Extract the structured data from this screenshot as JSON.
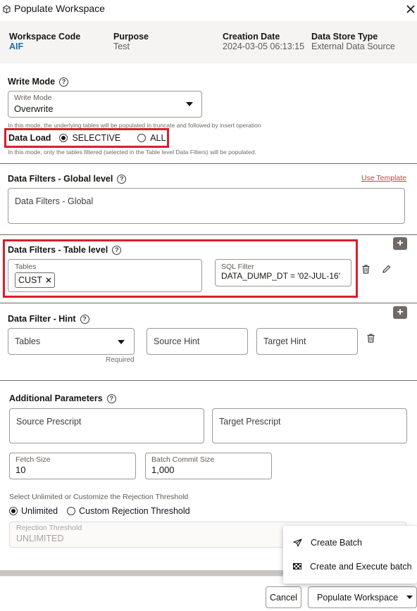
{
  "dialog": {
    "title": "Populate Workspace",
    "info": [
      {
        "label": "Workspace Code",
        "value": "AIF"
      },
      {
        "label": "Purpose",
        "value": "Test"
      },
      {
        "label": "Creation Date",
        "value": "2024-03-05 06:13:15"
      },
      {
        "label": "Data Store Type",
        "value": "External Data Source"
      }
    ]
  },
  "write_mode": {
    "section_title": "Write Mode",
    "field_label": "Write Mode",
    "value": "Overwrite",
    "hint": "In this mode, the underlying tables will be populated in truncate and followed by insert operation"
  },
  "data_load": {
    "label": "Data Load",
    "options": [
      "SELECTIVE",
      "ALL"
    ],
    "selected": "SELECTIVE",
    "hint": "In this mode, only the tables filtered (selected in the Table level Data Filters) will be populated."
  },
  "global_filters": {
    "section_title": "Data Filters - Global level",
    "use_template": "Use Template",
    "placeholder": "Data Filters - Global"
  },
  "table_filters": {
    "section_title": "Data Filters - Table level",
    "tables_label": "Tables",
    "chip": "CUST",
    "sql_label": "SQL Filter",
    "sql_value": "DATA_DUMP_DT = '02-JUL-16'"
  },
  "hint_filter": {
    "section_title": "Data Filter - Hint",
    "tables_placeholder": "Tables",
    "required": "Required",
    "source_hint": "Source Hint",
    "target_hint": "Target Hint"
  },
  "additional": {
    "section_title": "Additional Parameters",
    "source_prescript": "Source Prescript",
    "target_prescript": "Target Prescript",
    "fetch_size_label": "Fetch Size",
    "fetch_size": "10",
    "batch_commit_label": "Batch Commit Size",
    "batch_commit": "1,000",
    "rejection_caption": "Select Unlimited or Customize the Rejection Threshold",
    "rejection_options": [
      "Unlimited",
      "Custom Rejection Threshold"
    ],
    "rejection_selected": "Unlimited",
    "threshold_label": "Rejection Threshold",
    "threshold_value": "UNLIMITED"
  },
  "menu": {
    "items": [
      "Create Batch",
      "Create and Execute batch"
    ]
  },
  "footer": {
    "cancel": "Cancel",
    "populate": "Populate Workspace"
  },
  "colors": {
    "highlight": "#d71f2d",
    "link": "#c74634",
    "code": "#1d6ba3"
  }
}
